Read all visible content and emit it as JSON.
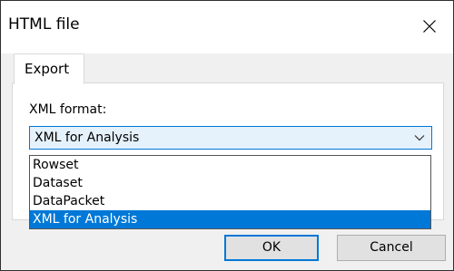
{
  "window": {
    "title": "HTML file",
    "close_icon": "close-icon"
  },
  "tabs": [
    {
      "label": "Export",
      "active": true
    }
  ],
  "export": {
    "format_label": "XML format:",
    "selected_value": "XML for Analysis",
    "options": [
      "Rowset",
      "Dataset",
      "DataPacket",
      "XML for Analysis"
    ],
    "highlighted_option": "XML for Analysis"
  },
  "buttons": {
    "ok_label": "OK",
    "cancel_label": "Cancel"
  },
  "colors": {
    "accent": "#0078d7",
    "select_bg": "#e5f1fb",
    "dialog_bg": "#f0f0f0"
  }
}
